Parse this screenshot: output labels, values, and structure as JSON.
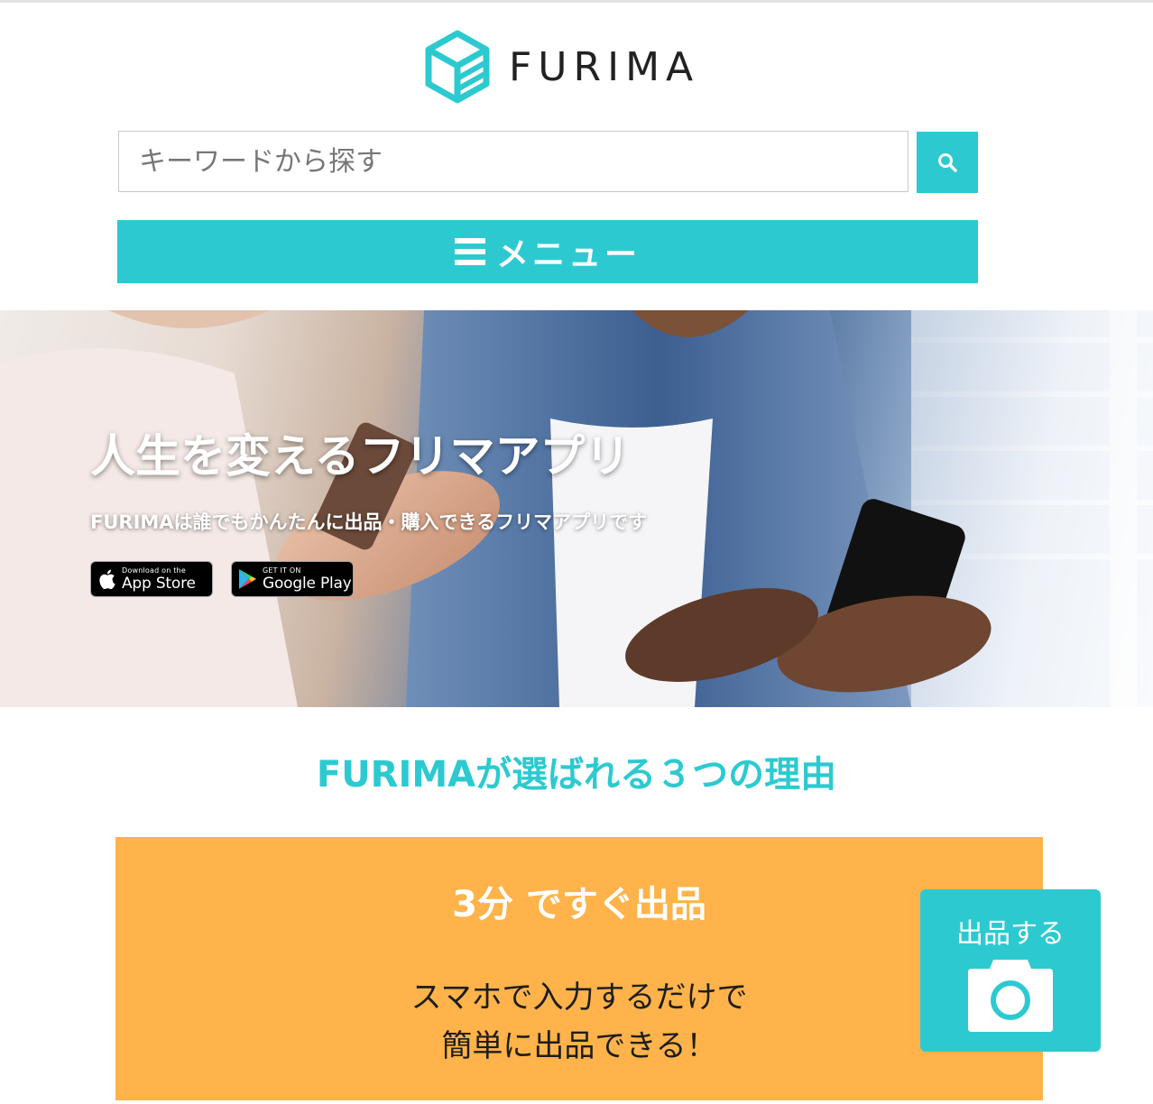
{
  "header": {
    "logo_text": "FURIMA",
    "brand_color": "#2ccad0"
  },
  "search": {
    "placeholder": "キーワードから探す",
    "value": "",
    "button_icon": "search-icon"
  },
  "menu": {
    "icon": "hamburger-icon",
    "label": "メニュー"
  },
  "hero": {
    "title": "人生を変えるフリマアプリ",
    "subtitle": "FURIMAは誰でもかんたんに出品・購入できるフリマアプリです",
    "app_store": {
      "small": "Download on the",
      "big": "App Store",
      "icon": "apple-icon"
    },
    "google_play": {
      "small": "GET IT ON",
      "big": "Google Play",
      "icon": "google-play-icon"
    }
  },
  "reasons": {
    "title": "FURIMAが選ばれる３つの理由",
    "card": {
      "color": "#ffb34a",
      "title": "3分 ですぐ出品",
      "line1": "スマホで入力するだけで",
      "line2": "簡単に出品できる！"
    }
  },
  "sell_button": {
    "label": "出品する",
    "icon": "camera-icon"
  }
}
